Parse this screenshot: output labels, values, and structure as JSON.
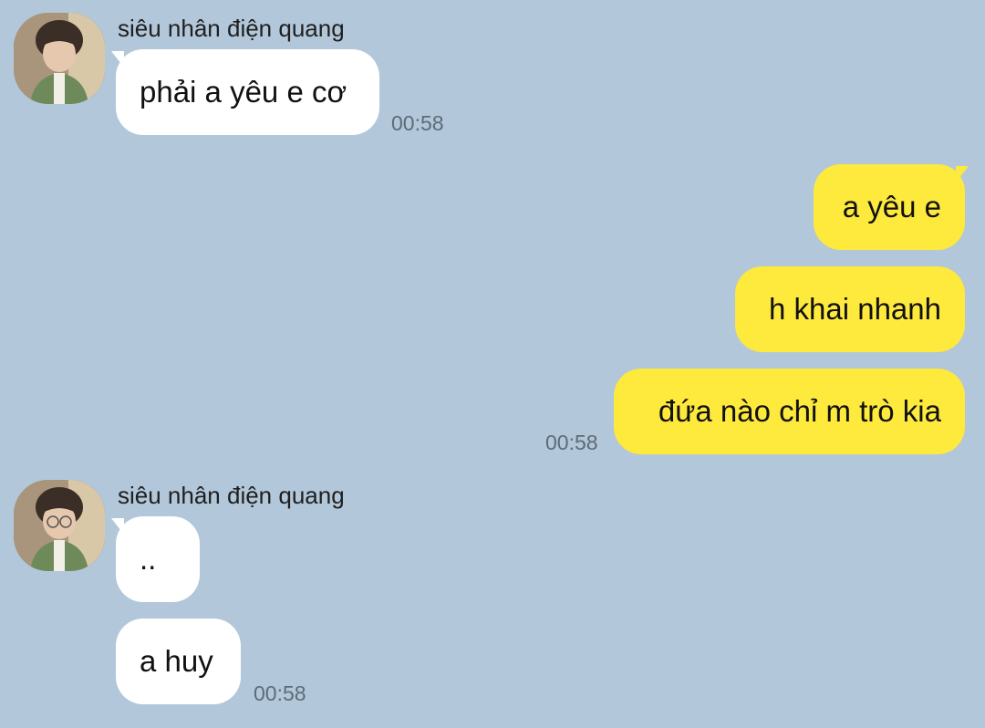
{
  "colors": {
    "background": "#b2c7da",
    "incoming_bubble": "#ffffff",
    "outgoing_bubble": "#fee93d",
    "timestamp": "#5f6b76"
  },
  "messages": [
    {
      "sender": "siêu nhân điện quang",
      "avatar": "profile-photo",
      "bubbles": [
        "phải a yêu e cơ"
      ],
      "time": "00:58"
    },
    {
      "sender": "me",
      "bubbles": [
        "a yêu e",
        "h khai nhanh",
        "đứa nào chỉ m trò kia"
      ],
      "time": "00:58"
    },
    {
      "sender": "siêu nhân điện quang",
      "avatar": "profile-photo",
      "bubbles": [
        "..",
        "a huy"
      ],
      "time": "00:58"
    }
  ]
}
